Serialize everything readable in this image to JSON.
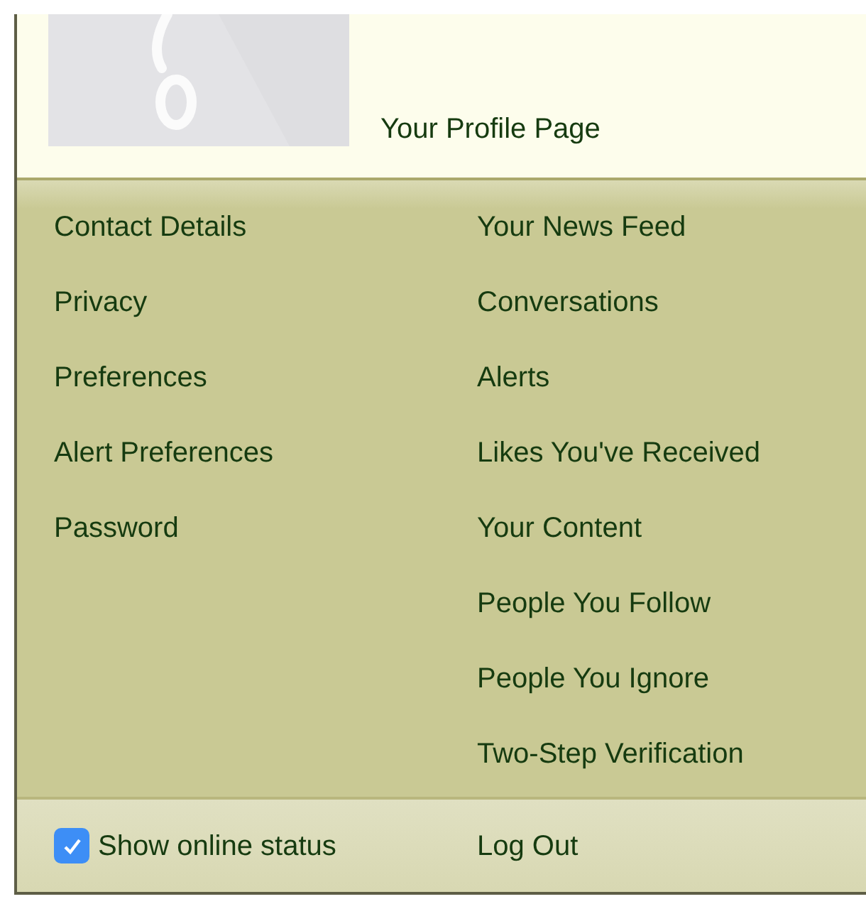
{
  "profile": {
    "title": "Your Profile Page"
  },
  "menu": {
    "left": [
      "Contact Details",
      "Privacy",
      "Preferences",
      "Alert Preferences",
      "Password"
    ],
    "right": [
      "Your News Feed",
      "Conversations",
      "Alerts",
      "Likes You've Received",
      "Your Content",
      "People You Follow",
      "People You Ignore",
      "Two-Step Verification"
    ]
  },
  "footer": {
    "online_status": {
      "label": "Show online status",
      "checked": true
    },
    "logout": "Log Out"
  }
}
